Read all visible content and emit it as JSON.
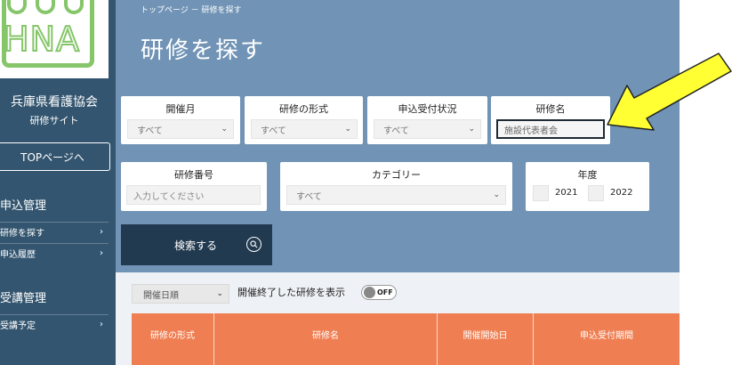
{
  "sidebar": {
    "logo_text": "HNA",
    "org_name": "兵庫県看護協会",
    "org_sub": "研修サイト",
    "top_button": "TOPページへ",
    "sections": [
      {
        "title": "申込管理",
        "items": [
          "研修を探す",
          "申込履歴"
        ]
      },
      {
        "title": "受講管理",
        "items": [
          "受講予定"
        ]
      }
    ],
    "chevron": "›"
  },
  "header": {
    "breadcrumb": "トップページ － 研修を探す",
    "title": "研修を探す"
  },
  "filters": {
    "month": {
      "label": "開催月",
      "value": "すべて"
    },
    "format": {
      "label": "研修の形式",
      "value": "すべて"
    },
    "status": {
      "label": "申込受付状況",
      "value": "すべて"
    },
    "name": {
      "label": "研修名",
      "value": "施設代表者会"
    },
    "number": {
      "label": "研修番号",
      "placeholder": "入力してください"
    },
    "category": {
      "label": "カテゴリー",
      "value": "すべて"
    },
    "year": {
      "label": "年度",
      "options": [
        "2021",
        "2022"
      ]
    }
  },
  "search_button": {
    "label": "検索する",
    "icon": "search-icon"
  },
  "results": {
    "sort_value": "開催日順",
    "show_ended_label": "開催終了した研修を表示",
    "toggle_label": "OFF",
    "columns": [
      "研修の形式",
      "研修名",
      "開催開始日",
      "申込受付期間"
    ]
  },
  "colors": {
    "sidebar": "#33556f",
    "hero": "#7093b6",
    "search_button": "#223a50",
    "table_header": "#ef7f52",
    "annotation_arrow": "#ffff33",
    "logo_green": "#86c66a"
  }
}
